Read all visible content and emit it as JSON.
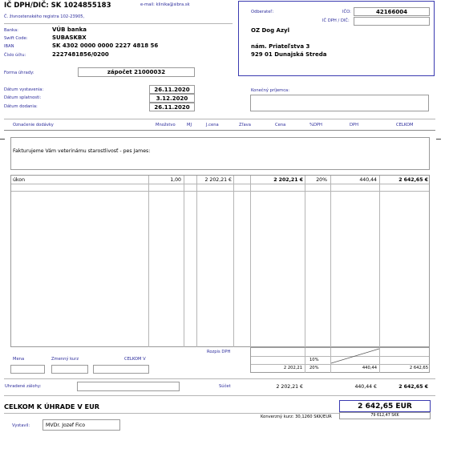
{
  "supplier": {
    "vat_id": "IČ DPH/DIČ: SK 1024855183",
    "email": "e-mail: klinika@sibra.sk",
    "registry": "Č. živnostenského registra 102-23905,",
    "bank_label": "Banka:",
    "bank": "VÚB banka",
    "swift_label": "Swift Code:",
    "swift": "SUBASKBX",
    "iban_label": "IBAN",
    "iban": "SK 4302 0000 0000 2227 4818 56",
    "account_label": "Číslo účtu:",
    "account": "2227481856/0200"
  },
  "customer": {
    "label": "Odberateľ:",
    "ico_label": "IČO:",
    "ico": "42166004",
    "vat_label": "IČ DPH / DIČ:",
    "vat": "",
    "name": "OZ Dog Azyl",
    "street": "nám. Priateľstva 3",
    "city": "929 01 Dunajská Streda"
  },
  "payment": {
    "form_label": "Forma úhrady:",
    "form": "zápočet 21000032",
    "issue_label": "Dátum vystavenia:",
    "issue": "26.11.2020",
    "due_label": "Dátum splatnosti:",
    "due": "3.12.2020",
    "delivery_label": "Dátum dodania:",
    "delivery": "26.11.2020",
    "recipient_label": "Konečný príjemca:"
  },
  "table": {
    "headers": [
      "Označenie dodávky",
      "Množstvo",
      "MJ",
      "J.cena",
      "Zľava",
      "Cena",
      "%DPH",
      "DPH",
      "CELKOM"
    ],
    "intro": "Fakturujeme Vám veterinámu starostlivosť - pes James:",
    "row": {
      "item": "úkon",
      "qty": "1,00",
      "unit": "",
      "unit_price": "2 202,21 €",
      "discount": "",
      "price": "2 202,21 €",
      "vat_rate": "20%",
      "vat": "440,44",
      "total": "2 642,65 €"
    }
  },
  "summary": {
    "vat_breakdown_label": "Rozpis DPH",
    "currency_label": "Mena",
    "rate_label": "Zmenný kurz",
    "total_in_label": "CELKOM V",
    "rate_row1": "10%",
    "rate_row2_base": "2 202,21",
    "rate_row2_pct": "20%",
    "rate_row2_vat": "440,44",
    "rate_row2_total": "2 642,65",
    "deposits_label": "Uhradené zálohy:",
    "sum_label": "Súčet",
    "sum_base": "2 202,21 €",
    "sum_vat": "440,44 €",
    "sum_total": "2 642,65 €",
    "grand_label": "CELKOM K ÚHRADE V EUR",
    "grand_total": "2 642,65 EUR",
    "conversion_label": "Konverzný kurz: 30,1260 SKK/EUR",
    "conversion_value": "79 612,47 SKK",
    "issued_by_label": "Vystavil:",
    "issued_by": "MVDr. Jozef Fico"
  }
}
